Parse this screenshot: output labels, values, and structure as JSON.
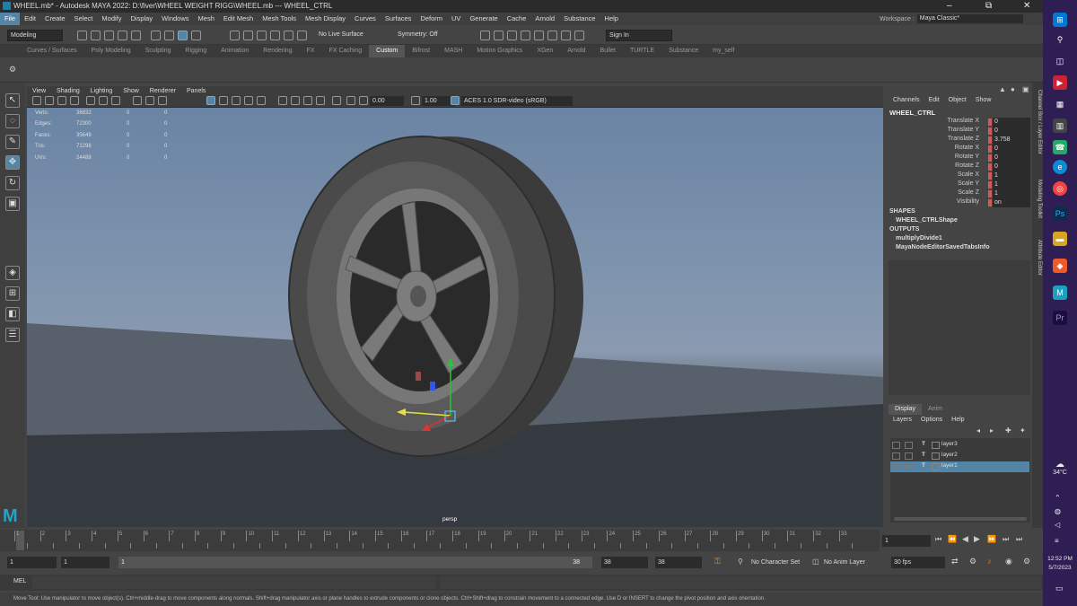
{
  "window": {
    "title": "WHEEL.mb* - Autodesk MAYA 2022: D:\\fiver\\WHEEL WEIGHT RIGG\\WHEEL.mb   ---   WHEEL_CTRL",
    "minimize": "–",
    "maximize": "⧉",
    "close": "✕"
  },
  "menubar": {
    "items": [
      "File",
      "Edit",
      "Create",
      "Select",
      "Modify",
      "Display",
      "Windows",
      "Mesh",
      "Edit Mesh",
      "Mesh Tools",
      "Mesh Display",
      "Curves",
      "Surfaces",
      "Deform",
      "UV",
      "Generate",
      "Cache",
      "Arnold",
      "Substance",
      "Help"
    ],
    "workspace_label": "Workspace :",
    "workspace_value": "Maya Classic*"
  },
  "toolbar": {
    "mode": "Modeling",
    "live_surface": "No Live Surface",
    "symmetry": "Symmetry: Off",
    "sign_in": "Sign In"
  },
  "shelf": {
    "tabs": [
      "Curves / Surfaces",
      "Poly Modeling",
      "Sculpting",
      "Rigging",
      "Animation",
      "Rendering",
      "FX",
      "FX Caching",
      "Custom",
      "Bifrost",
      "MASH",
      "Motion Graphics",
      "XGen",
      "Arnold",
      "Bullet",
      "TURTLE",
      "Substance",
      "my_self"
    ],
    "active_tab": "Custom"
  },
  "viewport": {
    "menu": [
      "View",
      "Shading",
      "Lighting",
      "Show",
      "Renderer",
      "Panels"
    ],
    "exposure": "0.00",
    "gamma": "1.00",
    "color_space": "ACES 1.0 SDR-video (sRGB)",
    "camera": "persp",
    "hud": [
      {
        "label": "Verts:",
        "v1": "36832",
        "v2": "0",
        "v3": "0"
      },
      {
        "label": "Edges:",
        "v1": "72300",
        "v2": "0",
        "v3": "0"
      },
      {
        "label": "Faces:",
        "v1": "35649",
        "v2": "0",
        "v3": "0"
      },
      {
        "label": "Tris:",
        "v1": "71298",
        "v2": "0",
        "v3": "0"
      },
      {
        "label": "UVs:",
        "v1": "24488",
        "v2": "0",
        "v3": "0"
      }
    ]
  },
  "channel_box": {
    "menu": [
      "Channels",
      "Edit",
      "Object",
      "Show"
    ],
    "object": "WHEEL_CTRL",
    "attributes": [
      {
        "name": "Translate X",
        "value": "0"
      },
      {
        "name": "Translate Y",
        "value": "0"
      },
      {
        "name": "Translate Z",
        "value": "3.758"
      },
      {
        "name": "Rotate X",
        "value": "0"
      },
      {
        "name": "Rotate Y",
        "value": "0"
      },
      {
        "name": "Rotate Z",
        "value": "0"
      },
      {
        "name": "Scale X",
        "value": "1"
      },
      {
        "name": "Scale Y",
        "value": "1"
      },
      {
        "name": "Scale Z",
        "value": "1"
      },
      {
        "name": "Visibility",
        "value": "on"
      }
    ],
    "shapes_header": "SHAPES",
    "shape": "WHEEL_CTRLShape",
    "outputs_header": "OUTPUTS",
    "outputs": [
      "multiplyDivide1",
      "MayaNodeEditorSavedTabsInfo"
    ]
  },
  "side_tabs": [
    "Channel Box / Layer Editor",
    "Modeling Toolkit",
    "Attribute Editor"
  ],
  "layer_editor": {
    "tabs": [
      "Display",
      "Anim"
    ],
    "menu": [
      "Layers",
      "Options",
      "Help"
    ],
    "layers": [
      {
        "t": "T",
        "name": "layer3",
        "selected": false
      },
      {
        "t": "T",
        "name": "layer2",
        "selected": false
      },
      {
        "t": "T",
        "name": "layer1",
        "selected": true
      }
    ]
  },
  "timeline": {
    "ticks": [
      "1",
      "2",
      "3",
      "4",
      "5",
      "6",
      "7",
      "8",
      "9",
      "10",
      "11",
      "12",
      "13",
      "14",
      "15",
      "16",
      "17",
      "18",
      "19",
      "20",
      "21",
      "22",
      "23",
      "24",
      "25",
      "26",
      "27",
      "28",
      "29",
      "30",
      "31",
      "32",
      "33"
    ],
    "current_frame": "1"
  },
  "range": {
    "start": "1",
    "start2": "1",
    "slider_start": "1",
    "slider_end": "38",
    "end": "38",
    "end2": "38",
    "character_set": "No Character Set",
    "anim_layer": "No Anim Layer",
    "fps": "30 fps"
  },
  "mel": {
    "label": "MEL"
  },
  "help_line": "Move Tool: Use manipulator to move object(s). Ctrl+middle-drag to move components along normals. Shift+drag manipulator axis or plane handles to extrude components or clone objects. Ctrl+Shift+drag to constrain movement to a connected edge. Use D or INSERT to change the pivot position and axis orientation.",
  "taskbar": {
    "temperature": "34°C",
    "time": "12:52 PM",
    "date": "5/7/2023"
  }
}
